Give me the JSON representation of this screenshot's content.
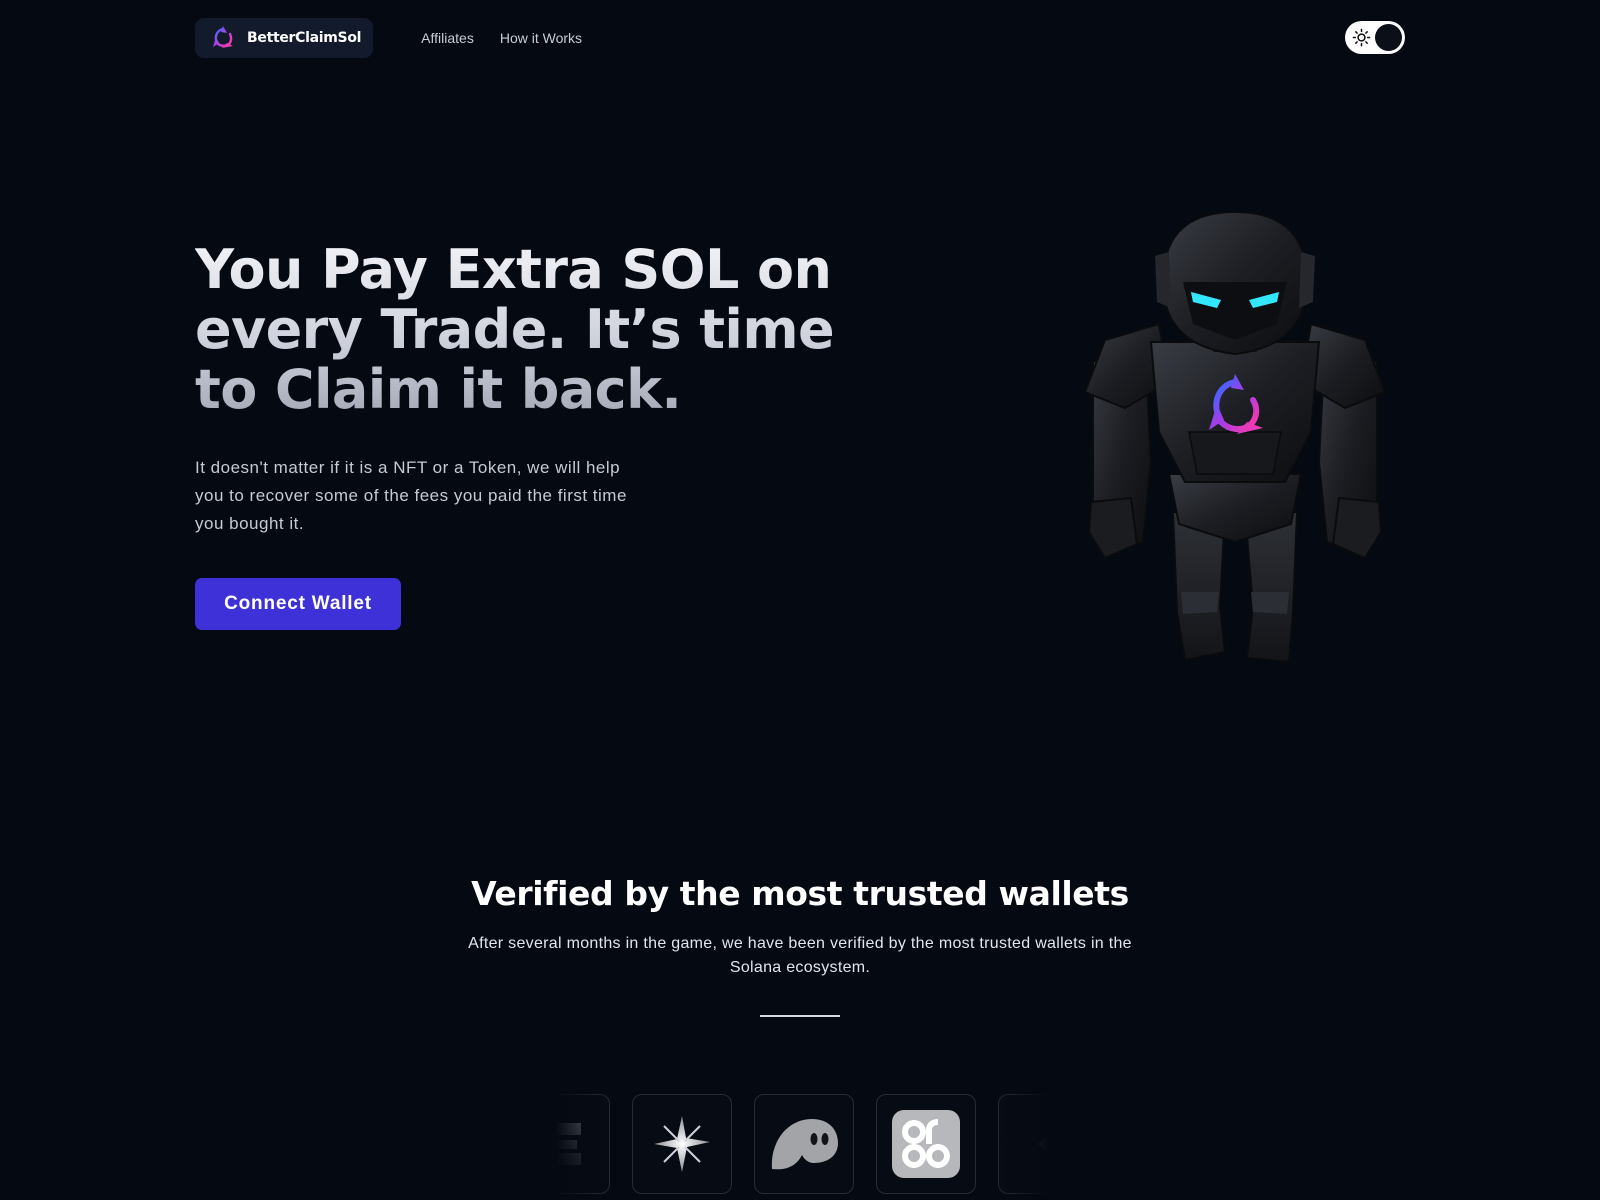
{
  "nav": {
    "brand": "BetterClaimSol",
    "links": [
      "Affiliates",
      "How it Works"
    ],
    "theme_toggle_icon": "sun-icon"
  },
  "hero": {
    "title": "You Pay Extra SOL on every Trade. It’s time to Claim it back.",
    "subtitle": "It doesn't matter if it is a NFT or a Token, we will help you to recover some of the fees you paid the first time you bought it.",
    "cta": "Connect Wallet",
    "mascot": "robot-mascot"
  },
  "verified": {
    "title": "Verified by the most trusted wallets",
    "description": "After several months in the game, we have been verified by the most trusted wallets in the Solana ecosystem.",
    "wallets": [
      "e-wallet-icon",
      "star-wallet-icon",
      "ghost-wallet-icon",
      "ok-wallet-icon",
      "chevron-wallet-icon"
    ]
  },
  "colors": {
    "background": "#050912",
    "accent": "#3f31d8",
    "logo_gradient": [
      "#3b6cff",
      "#c03ce0",
      "#ff3da0"
    ]
  }
}
